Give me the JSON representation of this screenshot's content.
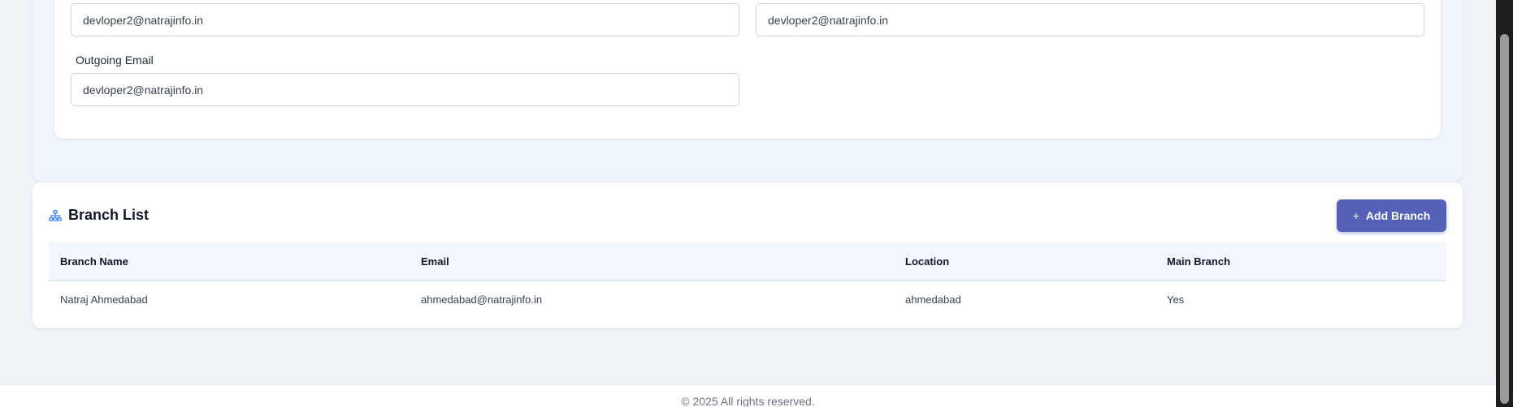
{
  "company_settings": {
    "field_left_value": "devloper2@natrajinfo.in",
    "field_right_value": "devloper2@natrajinfo.in",
    "outgoing_email_label": "Outgoing Email",
    "outgoing_email_value": "devloper2@natrajinfo.in"
  },
  "branch_list": {
    "title": "Branch List",
    "icon": "sitemap-icon",
    "add_button_label": "Add Branch",
    "add_button_icon": "+",
    "columns": [
      "Branch Name",
      "Email",
      "Location",
      "Main Branch"
    ],
    "rows": [
      {
        "branch_name": "Natraj Ahmedabad",
        "email": "ahmedabad@natrajinfo.in",
        "location": "ahmedabad",
        "main_branch": "Yes"
      }
    ],
    "colors": {
      "accent": "#5560b7",
      "icon": "#3b82f6"
    }
  },
  "footer": {
    "copyright": "© 2025 All rights reserved."
  }
}
